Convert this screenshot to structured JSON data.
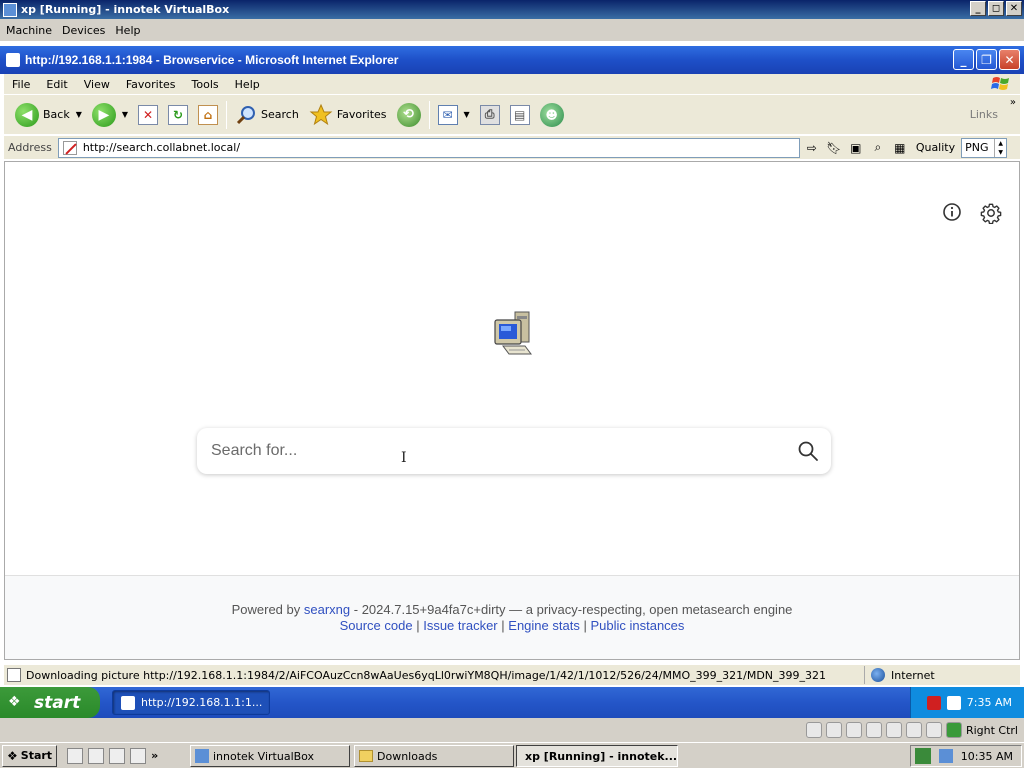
{
  "host_window": {
    "title": "xp [Running] - innotek VirtualBox",
    "menu": [
      "Machine",
      "Devices",
      "Help"
    ],
    "buttons": {
      "minimize": "_",
      "restore": "◻",
      "close": "✕"
    }
  },
  "ie_window": {
    "title": "http://192.168.1.1:1984 - Browservice - Microsoft Internet Explorer",
    "menu": [
      "File",
      "Edit",
      "View",
      "Favorites",
      "Tools",
      "Help"
    ],
    "toolbar": {
      "back_label": "Back",
      "search_label": "Search",
      "favorites_label": "Favorites",
      "links_label": "Links"
    },
    "address": {
      "label": "Address",
      "url": "http://search.collabnet.local/",
      "quality_label": "Quality",
      "quality_value": "PNG"
    },
    "status": {
      "text": "Downloading picture http://192.168.1.1:1984/2/AiFCOAuzCcn8wAaUes6yqLl0rwiYM8QH/image/1/42/1/1012/526/24/MMO_399_321/MDN_399_321",
      "zone": "Internet"
    }
  },
  "page": {
    "search_placeholder": "Search for...",
    "footer": {
      "powered_by": "Powered by",
      "engine_name": "searxng",
      "version_text": "- 2024.7.15+9a4fa7c+dirty — a privacy-respecting, open metasearch engine",
      "links": [
        "Source code",
        "Issue tracker",
        "Engine stats",
        "Public instances"
      ],
      "separator": "|"
    }
  },
  "guest_taskbar": {
    "start_label": "start",
    "task_label": "http://192.168.1.1:1...",
    "clock": "7:35 AM"
  },
  "vb_statusbar": {
    "host_key": "Right Ctrl"
  },
  "host_taskbar": {
    "start_label": "Start",
    "tasks": [
      {
        "label": "innotek VirtualBox",
        "active": false
      },
      {
        "label": "Downloads",
        "active": false
      },
      {
        "label": "xp [Running] - innotek...",
        "active": true
      }
    ],
    "clock": "10:35 AM"
  },
  "colors": {
    "xp_blue": "#245edb",
    "searx_link": "#3050c0",
    "xp_start_green": "#3c9a3a"
  },
  "icons": [
    "back-icon",
    "forward-icon",
    "stop-icon",
    "refresh-icon",
    "home-icon",
    "search-icon",
    "favorites-star-icon",
    "history-icon",
    "mail-icon",
    "print-icon",
    "edit-icon",
    "messenger-icon",
    "info-icon",
    "settings-gear-icon",
    "searxng-logo",
    "search-magnifier-icon",
    "globe-icon"
  ]
}
